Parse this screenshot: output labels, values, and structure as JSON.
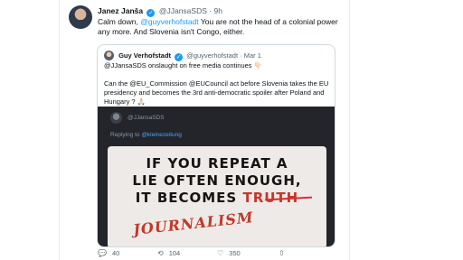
{
  "tweet": {
    "author_name": "Janez Janša",
    "author_handle": "@JJansaSDS",
    "time": "9h",
    "text_before": "Calm down, ",
    "mention": "@guyverhofstadt",
    "text_after": " You are not the head of a colonial power any more. And Slovenia isn't Congo, either."
  },
  "quote": {
    "author_name": "Guy Verhofstadt",
    "author_handle": "@guyverhofstadt",
    "date": "Mar 1",
    "line1": "@JJansaSDS onslaught on free media continues 👇🏻",
    "line2": "Can the @EU_Commission @EUCouncil act before Slovenia takes the EU presidency and becomes the 3rd anti-democratic spoiler after Poland and Hungary ? 🙏🏻",
    "media": {
      "handle": "@JJansaSDS",
      "replying_prefix": "Replying to ",
      "replying_mention": "@kleinezeitung",
      "sign_line1": "IF YOU REPEAT A",
      "sign_line2": "LIE OFTEN ENOUGH,",
      "sign_line3_a": "IT BECOMES ",
      "sign_line3_struck": "TRUTH",
      "sign_handwritten": "JOURNALISM"
    }
  },
  "actions": {
    "replies": "40",
    "retweets": "104",
    "likes": "350",
    "reply_icon": "💬",
    "retweet_icon": "⟲",
    "like_icon": "♡",
    "share_icon": "⇧"
  },
  "colors": {
    "accent": "#1d9bf0",
    "text": "#0f1419",
    "muted": "#536471",
    "border": "#cfd9de",
    "sign_red": "#c0392b"
  }
}
